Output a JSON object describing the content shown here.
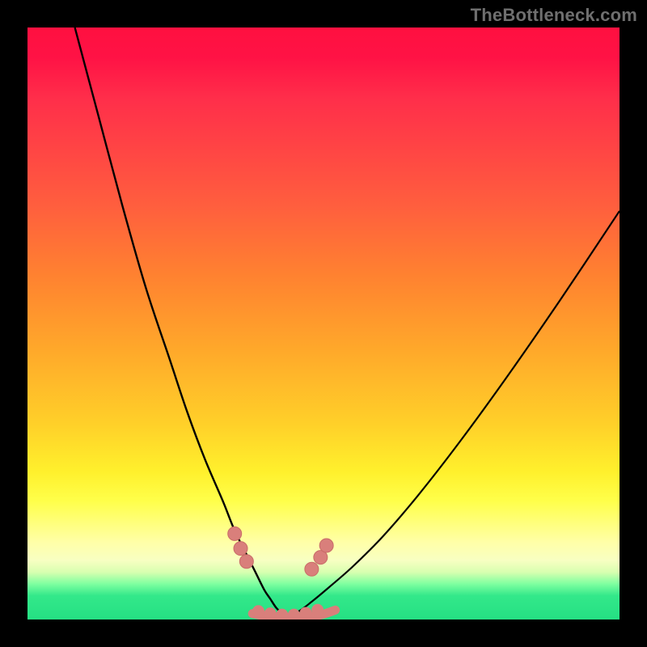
{
  "watermark": "TheBottleneck.com",
  "colors": {
    "frame": "#000000",
    "curve": "#000000",
    "marker_fill": "#d97f7b",
    "marker_stroke": "#c96c68",
    "gradient_stops": [
      "#ff1040",
      "#ff1245",
      "#ff2e4a",
      "#ff5e3e",
      "#ff8230",
      "#ffaa2a",
      "#ffd029",
      "#fff02c",
      "#ffff4a",
      "#ffff80",
      "#ffffa8",
      "#f8ffc2",
      "#d8ffb0",
      "#7effa0",
      "#33e88a",
      "#25e083"
    ]
  },
  "chart_data": {
    "type": "line",
    "title": "",
    "xlabel": "",
    "ylabel": "",
    "xlim": [
      0,
      100
    ],
    "ylim": [
      0,
      100
    ],
    "grid": false,
    "legend": false,
    "left_curve": {
      "x": [
        8,
        12,
        16,
        20,
        24,
        27,
        30,
        33,
        35,
        37,
        38.5,
        40,
        41,
        42,
        43,
        44
      ],
      "y": [
        100,
        85,
        70,
        56,
        44,
        35,
        27,
        20,
        15,
        11,
        8,
        5,
        3.5,
        2.0,
        1.0,
        0.5
      ]
    },
    "right_curve": {
      "x": [
        44,
        46,
        48,
        51,
        55,
        60,
        66,
        73,
        81,
        90,
        100
      ],
      "y": [
        0.5,
        1.5,
        3,
        5.5,
        9,
        14,
        21,
        30,
        41,
        54,
        69
      ]
    },
    "floor": {
      "x": [
        38,
        40,
        42,
        44,
        46,
        48,
        50,
        52
      ],
      "y": [
        1.0,
        0.6,
        0.4,
        0.3,
        0.3,
        0.5,
        0.9,
        1.6
      ]
    },
    "markers": [
      {
        "x": 35.0,
        "y": 14.5
      },
      {
        "x": 36.0,
        "y": 12.0
      },
      {
        "x": 37.0,
        "y": 9.8
      },
      {
        "x": 48.0,
        "y": 8.5
      },
      {
        "x": 49.5,
        "y": 10.5
      },
      {
        "x": 50.5,
        "y": 12.5
      }
    ],
    "bottom_markers": [
      {
        "x": 39.0,
        "y": 1.4
      },
      {
        "x": 41.0,
        "y": 1.0
      },
      {
        "x": 43.0,
        "y": 0.8
      },
      {
        "x": 45.0,
        "y": 0.8
      },
      {
        "x": 47.0,
        "y": 1.1
      },
      {
        "x": 49.0,
        "y": 1.6
      }
    ]
  }
}
